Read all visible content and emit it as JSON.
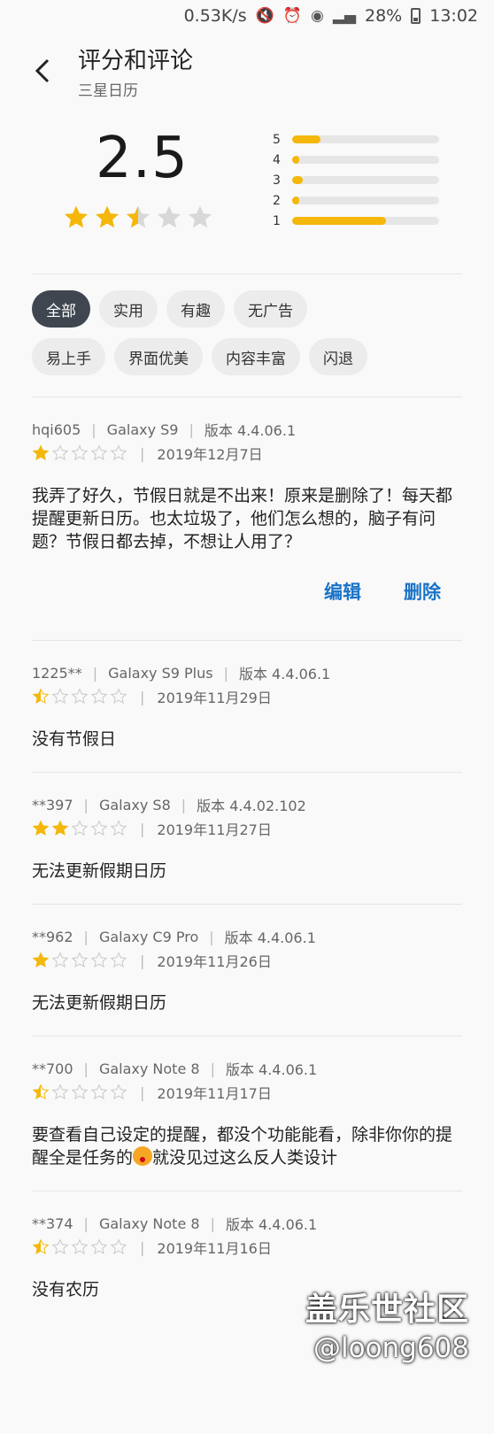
{
  "status_bar": {
    "speed": "0.53K/s",
    "battery": "28%",
    "time": "13:02"
  },
  "header": {
    "title": "评分和评论",
    "subtitle": "三星日历"
  },
  "summary": {
    "score": "2.5",
    "stars": 2.5,
    "star_color": "#f4b70a",
    "bars": [
      {
        "label": "5",
        "fraction": 0.19
      },
      {
        "label": "4",
        "fraction": 0.05
      },
      {
        "label": "3",
        "fraction": 0.07
      },
      {
        "label": "2",
        "fraction": 0.05
      },
      {
        "label": "1",
        "fraction": 0.64
      }
    ]
  },
  "filters": {
    "row1": [
      "全部",
      "实用",
      "有趣",
      "无广告"
    ],
    "row2": [
      "易上手",
      "界面优美",
      "内容丰富",
      "闪退"
    ],
    "active": "全部"
  },
  "reviews": [
    {
      "user": "hqi605",
      "device": "Galaxy S9",
      "version": "版本 4.4.06.1",
      "stars": 1,
      "date": "2019年12月7日",
      "text": "我弄了好久，节假日就是不出来！原来是删除了！每天都提醒更新日历。也太垃圾了，他们怎么想的，脑子有问题？节假日都去掉，不想让人用了？",
      "edit": "编辑",
      "delete": "删除"
    },
    {
      "user": "1225**",
      "device": "Galaxy S9 Plus",
      "version": "版本 4.4.06.1",
      "stars": 0.5,
      "date": "2019年11月29日",
      "text": "没有节假日"
    },
    {
      "user": "**397",
      "device": "Galaxy S8",
      "version": "版本 4.4.02.102",
      "stars": 2,
      "date": "2019年11月27日",
      "text": "无法更新假期日历"
    },
    {
      "user": "**962",
      "device": "Galaxy C9 Pro",
      "version": "版本 4.4.06.1",
      "stars": 1,
      "date": "2019年11月26日",
      "text": "无法更新假期日历"
    },
    {
      "user": "**700",
      "device": "Galaxy Note 8",
      "version": "版本 4.4.06.1",
      "stars": 0.5,
      "date": "2019年11月17日",
      "text_a": "要查看自己设定的提醒，都没个功能能看，除非你你的提醒全是任务的",
      "text_b": "就没见过这么反人类设计"
    },
    {
      "user": "**374",
      "device": "Galaxy Note 8",
      "version": "版本 4.4.06.1",
      "stars": 0.5,
      "date": "2019年11月16日",
      "text": "没有农历"
    }
  ],
  "watermark": {
    "line1": "盖乐世社区",
    "line2": "@loong608"
  }
}
